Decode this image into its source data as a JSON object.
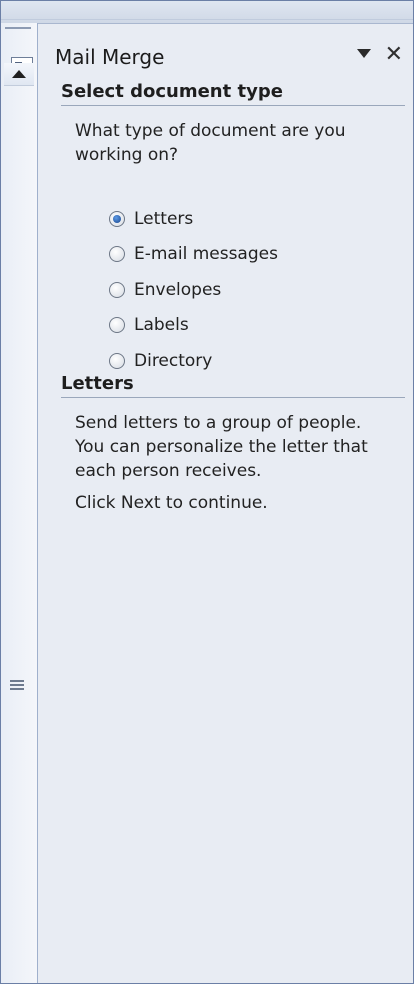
{
  "pane": {
    "title": "Mail Merge",
    "menu_icon": "dropdown-arrow-icon",
    "close_icon": "close-icon",
    "close_symbol": "✕"
  },
  "select_type": {
    "heading": "Select document type",
    "question": "What type of document are you working on?",
    "options": [
      {
        "label": "Letters",
        "checked": true
      },
      {
        "label": "E-mail messages",
        "checked": false
      },
      {
        "label": "Envelopes",
        "checked": false
      },
      {
        "label": "Labels",
        "checked": false
      },
      {
        "label": "Directory",
        "checked": false
      }
    ]
  },
  "description": {
    "heading": "Letters",
    "body": "Send letters to a group of people. You can personalize the letter that each person receives.",
    "instruction": "Click Next to continue."
  }
}
